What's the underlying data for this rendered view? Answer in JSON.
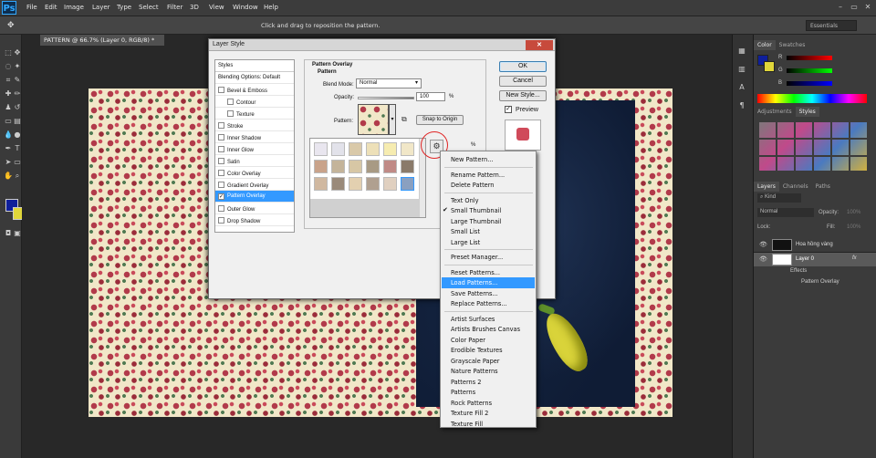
{
  "app": {
    "logo": "Ps",
    "menu": [
      "File",
      "Edit",
      "Image",
      "Layer",
      "Type",
      "Select",
      "Filter",
      "3D",
      "View",
      "Window",
      "Help"
    ],
    "window_controls": [
      "–",
      "▭",
      "✕"
    ]
  },
  "options": {
    "hint": "Click and drag to reposition the pattern.",
    "workspace": "Essentials"
  },
  "document": {
    "tab": "PATTERN @ 66.7% (Layer 0, RGB/8) *"
  },
  "dialog": {
    "title": "Layer Style",
    "styles_header": "Styles",
    "styles": [
      {
        "label": "Blending Options: Default",
        "check": false,
        "checked": false
      },
      {
        "label": "Bevel & Emboss",
        "check": true,
        "checked": false
      },
      {
        "label": "Contour",
        "check": true,
        "checked": false
      },
      {
        "label": "Texture",
        "check": true,
        "checked": false
      },
      {
        "label": "Stroke",
        "check": true,
        "checked": false
      },
      {
        "label": "Inner Shadow",
        "check": true,
        "checked": false
      },
      {
        "label": "Inner Glow",
        "check": true,
        "checked": false
      },
      {
        "label": "Satin",
        "check": true,
        "checked": false
      },
      {
        "label": "Color Overlay",
        "check": true,
        "checked": false
      },
      {
        "label": "Gradient Overlay",
        "check": true,
        "checked": false
      },
      {
        "label": "Pattern Overlay",
        "check": true,
        "checked": true,
        "selected": true
      },
      {
        "label": "Outer Glow",
        "check": true,
        "checked": false
      },
      {
        "label": "Drop Shadow",
        "check": true,
        "checked": false
      }
    ],
    "section": "Pattern Overlay",
    "subsection": "Pattern",
    "blend_mode_label": "Blend Mode:",
    "blend_mode": "Normal",
    "opacity_label": "Opacity:",
    "opacity": "100",
    "percent": "%",
    "pattern_label": "Pattern:",
    "snap_label": "Snap to Origin",
    "ok": "OK",
    "cancel": "Cancel",
    "new_style": "New Style...",
    "preview": "Preview"
  },
  "context_menu": {
    "items": [
      "New Pattern...",
      "Rename Pattern...",
      "Delete Pattern",
      "Text Only",
      "Small Thumbnail",
      "Large Thumbnail",
      "Small List",
      "Large List",
      "Preset Manager...",
      "Reset Patterns...",
      "Load Patterns...",
      "Save Patterns...",
      "Replace Patterns...",
      "Artist Surfaces",
      "Artists Brushes Canvas",
      "Color Paper",
      "Erodible Textures",
      "Grayscale Paper",
      "Nature Patterns",
      "Patterns 2",
      "Patterns",
      "Rock Patterns",
      "Texture Fill 2",
      "Texture Fill"
    ],
    "checked": "Small Thumbnail",
    "highlighted": "Load Patterns..."
  },
  "right_panel": {
    "color_tabs": [
      "Color",
      "Swatches"
    ],
    "rgb_labels": [
      "R",
      "G",
      "B"
    ],
    "style_tabs": [
      "Adjustments",
      "Styles"
    ],
    "layer_tabs": [
      "Layers",
      "Channels",
      "Paths"
    ],
    "kind": "Kind",
    "blend": "Normal",
    "opacity_label": "Opacity:",
    "opacity": "100%",
    "lock_label": "Lock:",
    "fill_label": "Fill:",
    "fill": "100%",
    "layers": [
      {
        "name": "Hoa hồng vàng"
      },
      {
        "name": "Layer 0",
        "fx": "fx"
      },
      {
        "name": "Effects"
      },
      {
        "name": "Pattern Overlay"
      }
    ]
  }
}
